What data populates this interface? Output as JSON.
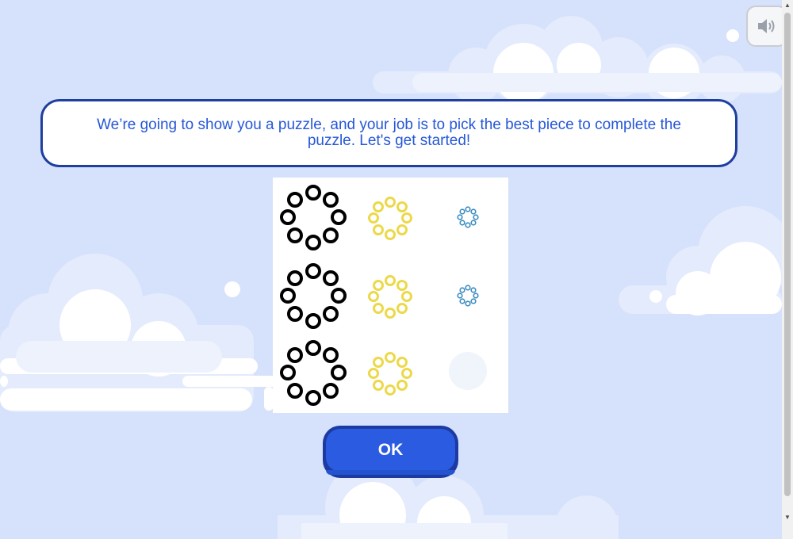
{
  "instruction": {
    "text": "We’re going to show you a puzzle, and your job is to pick the best piece to complete the puzzle. Let's get started!"
  },
  "buttons": {
    "ok_label": "OK"
  },
  "sound_button": {
    "icon": "speaker-icon"
  },
  "puzzle": {
    "grid": "3x3",
    "cells": [
      {
        "row": 1,
        "col": 1,
        "shape": "ring-of-circles",
        "color": "#000000",
        "size": "large",
        "circles": 8
      },
      {
        "row": 1,
        "col": 2,
        "shape": "ring-of-circles",
        "color": "#ecd94a",
        "size": "medium",
        "circles": 8
      },
      {
        "row": 1,
        "col": 3,
        "shape": "ring-of-circles",
        "color": "#3a8cc0",
        "size": "small",
        "circles": 8
      },
      {
        "row": 2,
        "col": 1,
        "shape": "ring-of-circles",
        "color": "#000000",
        "size": "large",
        "circles": 8
      },
      {
        "row": 2,
        "col": 2,
        "shape": "ring-of-circles",
        "color": "#ecd94a",
        "size": "medium",
        "circles": 8
      },
      {
        "row": 2,
        "col": 3,
        "shape": "ring-of-circles",
        "color": "#3a8cc0",
        "size": "small",
        "circles": 8
      },
      {
        "row": 3,
        "col": 1,
        "shape": "ring-of-circles",
        "color": "#000000",
        "size": "large",
        "circles": 8
      },
      {
        "row": 3,
        "col": 2,
        "shape": "ring-of-circles",
        "color": "#ecd94a",
        "size": "medium",
        "circles": 8
      },
      {
        "row": 3,
        "col": 3,
        "shape": "missing-piece",
        "color": "#f0f4fb"
      }
    ]
  },
  "colors": {
    "background": "#d6e2fb",
    "accent": "#2a5be0",
    "border": "#1f3f9e",
    "text": "#2557d6"
  }
}
